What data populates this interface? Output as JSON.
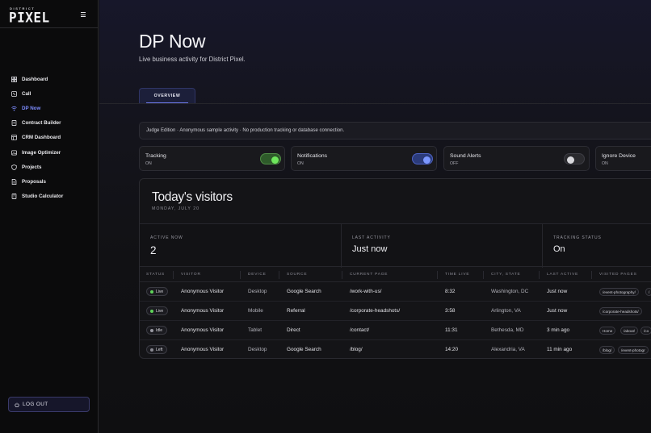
{
  "brand": {
    "top": "DISTRICT",
    "name": "PIXEL"
  },
  "nav": {
    "items": [
      {
        "label": "Dashboard",
        "icon": "grid-icon"
      },
      {
        "label": "Call",
        "icon": "phone-icon"
      },
      {
        "label": "DP Now",
        "icon": "wifi-icon",
        "active": true
      },
      {
        "label": "Contract Builder",
        "icon": "document-icon"
      },
      {
        "label": "CRM Dashboard",
        "icon": "layers-icon"
      },
      {
        "label": "Image Optimizer",
        "icon": "image-icon"
      },
      {
        "label": "Projects",
        "icon": "shield-icon"
      },
      {
        "label": "Proposals",
        "icon": "file-icon"
      },
      {
        "label": "Studio Calculator",
        "icon": "calculator-icon"
      }
    ],
    "logout_label": "LOG OUT"
  },
  "page": {
    "title": "DP Now",
    "subtitle": "Live business activity for District Pixel.",
    "tab_label": "OVERVIEW",
    "notice": "Judge Edition · Anonymous sample activity · No production tracking or database connection."
  },
  "toggles": [
    {
      "label": "Tracking",
      "state": "ON",
      "color": "#6ee65c"
    },
    {
      "label": "Notifications",
      "state": "ON",
      "color": "#7b97ff"
    },
    {
      "label": "Sound Alerts",
      "state": "OFF"
    },
    {
      "label": "Ignore Device",
      "state": "ON"
    }
  ],
  "visitors": {
    "title": "Today's visitors",
    "date": "MONDAY, JULY 20",
    "stats": [
      {
        "label": "ACTIVE NOW",
        "value": "2"
      },
      {
        "label": "LAST ACTIVITY",
        "value": "Just now"
      },
      {
        "label": "TRACKING STATUS",
        "value": "On"
      }
    ],
    "columns": [
      "STATUS",
      "VISITOR",
      "DEVICE",
      "SOURCE",
      "CURRENT PAGE",
      "TIME LIVE",
      "CITY, STATE",
      "LAST ACTIVE",
      "VISITED PAGES"
    ],
    "rows": [
      {
        "status": "Live",
        "status_color": "#5fd35a",
        "visitor": "Anonymous Visitor",
        "device": "Desktop",
        "source": "Google Search",
        "page": "/work-with-us/",
        "time": "8:32",
        "city": "Washington, DC",
        "last": "Just now",
        "visited": [
          "/event-photography/",
          "/"
        ]
      },
      {
        "status": "Live",
        "status_color": "#5fd35a",
        "visitor": "Anonymous Visitor",
        "device": "Mobile",
        "source": "Referral",
        "page": "/corporate-headshots/",
        "time": "3:58",
        "city": "Arlington, VA",
        "last": "Just now",
        "visited": [
          "/corporate-headshots/"
        ]
      },
      {
        "status": "Idle",
        "status_color": "#9a9aa3",
        "visitor": "Anonymous Visitor",
        "device": "Tablet",
        "source": "Direct",
        "page": "/contact/",
        "time": "11:31",
        "city": "Bethesda, MD",
        "last": "3 min ago",
        "visited": [
          "Home",
          "/about/",
          "/co"
        ]
      },
      {
        "status": "Left",
        "status_color": "#8a8a92",
        "visitor": "Anonymous Visitor",
        "device": "Desktop",
        "source": "Google Search",
        "page": "/blog/",
        "time": "14:20",
        "city": "Alexandria, VA",
        "last": "11 min ago",
        "visited": [
          "/blog/",
          "/event-photogr"
        ]
      }
    ]
  }
}
